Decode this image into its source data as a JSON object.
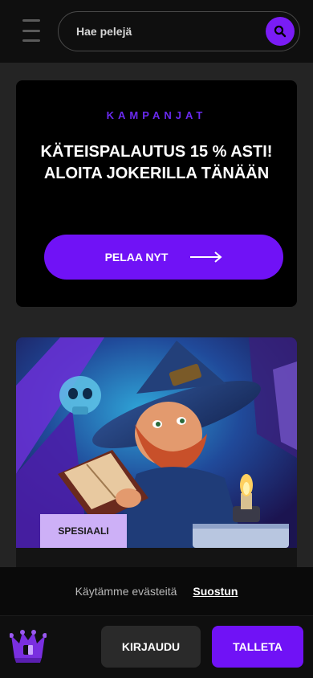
{
  "header": {
    "search_placeholder": "Hae pelejä"
  },
  "promo": {
    "kicker": "KAMPANJAT",
    "title": "KÄTEISPALAUTUS 15 % ASTI! ALOITA JOKERILLA TÄNÄÄN",
    "cta_label": "PELAA NYT"
  },
  "game": {
    "badge": "SPESIAALI"
  },
  "cookie": {
    "text": "Käytämme evästeitä",
    "accept_label": "Suostun"
  },
  "bottom": {
    "login_label": "KIRJAUDU",
    "deposit_label": "TALLETA"
  },
  "colors": {
    "accent": "#7012f6",
    "badge": "#cdb0f7",
    "kicker": "#6a2af0"
  },
  "icons": [
    "menu-icon",
    "search-icon",
    "arrow-right-icon",
    "jester-logo-icon"
  ]
}
